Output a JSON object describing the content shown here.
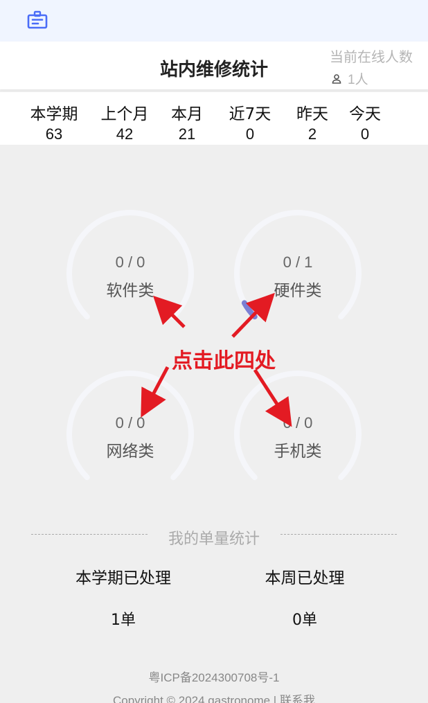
{
  "header": {
    "title": "站内维修统计",
    "online_label": "当前在线人数",
    "online_count": "1人"
  },
  "stats": [
    {
      "label": "本学期",
      "value": "63"
    },
    {
      "label": "上个月",
      "value": "42"
    },
    {
      "label": "本月",
      "value": "21"
    },
    {
      "label": "近7天",
      "value": "0"
    },
    {
      "label": "昨天",
      "value": "2"
    },
    {
      "label": "今天",
      "value": "0"
    }
  ],
  "gauges": [
    {
      "name": "软件类",
      "value": "0 / 0",
      "done": 0,
      "total": 0
    },
    {
      "name": "硬件类",
      "value": "0 / 1",
      "done": 0,
      "total": 1
    },
    {
      "name": "网络类",
      "value": "0 / 0",
      "done": 0,
      "total": 0
    },
    {
      "name": "手机类",
      "value": "0 / 0",
      "done": 0,
      "total": 0
    }
  ],
  "annotation": "点击此四处",
  "my_stats": {
    "title": "我的单量统计",
    "items": [
      {
        "label": "本学期已处理",
        "value": "1单"
      },
      {
        "label": "本周已处理",
        "value": "0单"
      }
    ]
  },
  "footer": {
    "icp": "粤ICP备2024300708号-1",
    "copyright": "Copyright © 2024 gastronome",
    "separator": " | ",
    "contact": "联系我"
  },
  "colors": {
    "accent": "#4a6cf7",
    "gauge_track": "#f5f6fa",
    "gauge_fill": "#7b7fd4",
    "annotation": "#e31b23"
  },
  "icons": {
    "top": "id-card-icon",
    "online": "user-icon"
  }
}
